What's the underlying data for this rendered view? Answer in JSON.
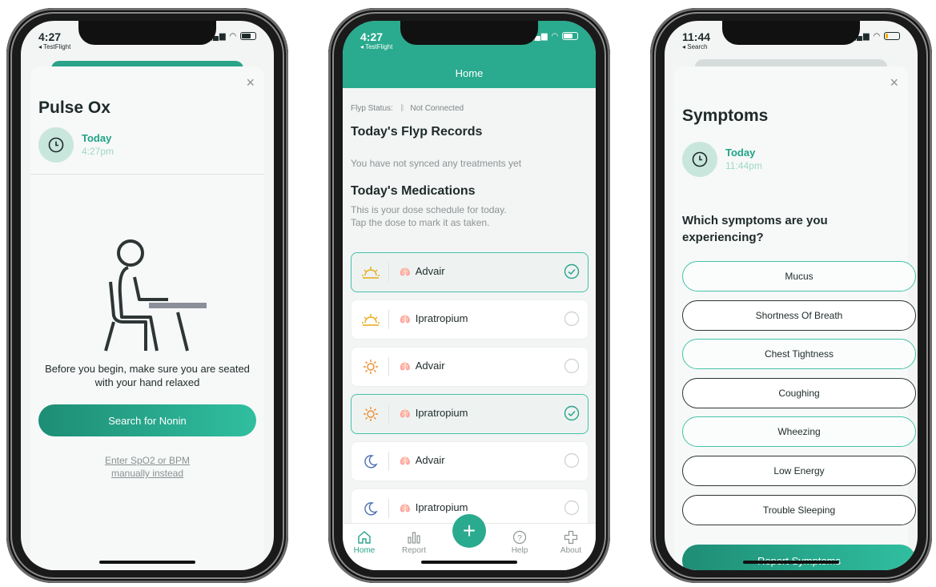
{
  "phone1": {
    "status": {
      "time": "4:27",
      "back": "◂ TestFlight"
    },
    "title": "Pulse Ox",
    "date": {
      "day": "Today",
      "time": "4:27pm"
    },
    "instruction_line1": "Before you begin, make sure you are seated",
    "instruction_line2": "with your hand relaxed",
    "search_button": "Search for Nonin",
    "manual_link_line1": "Enter SpO2 or BPM",
    "manual_link_line2": "manually instead",
    "close": "×"
  },
  "phone2": {
    "status": {
      "time": "4:27",
      "back": "◂ TestFlight"
    },
    "header_title": "Home",
    "flyp_status_label": "Flyp Status:",
    "flyp_status_value": "Not Connected",
    "records_title": "Today's Flyp Records",
    "records_empty": "You have not synced any treatments yet",
    "meds_title": "Today's Medications",
    "meds_desc_line1": "This is your dose schedule for today.",
    "meds_desc_line2": "Tap the dose to mark it as taken.",
    "medications": [
      {
        "time_icon": "sunrise-icon",
        "name": "Advair",
        "taken": true
      },
      {
        "time_icon": "sunrise-icon",
        "name": "Ipratropium",
        "taken": false
      },
      {
        "time_icon": "sun-icon",
        "name": "Advair",
        "taken": false
      },
      {
        "time_icon": "sun-icon",
        "name": "Ipratropium",
        "taken": true
      },
      {
        "time_icon": "moon-icon",
        "name": "Advair",
        "taken": false
      },
      {
        "time_icon": "moon-icon",
        "name": "Ipratropium",
        "taken": false
      }
    ],
    "tabs": [
      {
        "label": "Home",
        "icon": "home-icon",
        "active": true
      },
      {
        "label": "Report",
        "icon": "report-icon",
        "active": false
      },
      {
        "label": "Help",
        "icon": "help-icon",
        "active": false
      },
      {
        "label": "About",
        "icon": "about-icon",
        "active": false
      }
    ],
    "add_button": "+"
  },
  "phone3": {
    "status": {
      "time": "11:44",
      "back": "◂ Search"
    },
    "title": "Symptoms",
    "date": {
      "day": "Today",
      "time": "11:44pm"
    },
    "question_line1": "Which symptoms are you",
    "question_line2": "experiencing?",
    "symptoms": [
      {
        "label": "Mucus",
        "selected": true
      },
      {
        "label": "Shortness Of Breath",
        "selected": false
      },
      {
        "label": "Chest Tightness",
        "selected": true
      },
      {
        "label": "Coughing",
        "selected": false
      },
      {
        "label": "Wheezing",
        "selected": true
      },
      {
        "label": "Low Energy",
        "selected": false
      },
      {
        "label": "Trouble Sleeping",
        "selected": false
      }
    ],
    "report_button": "Report Symptoms",
    "close": "×"
  },
  "colors": {
    "accent": "#2aaa8e",
    "accent_light": "#c9e6dd",
    "selected_border": "#45c3a6"
  }
}
